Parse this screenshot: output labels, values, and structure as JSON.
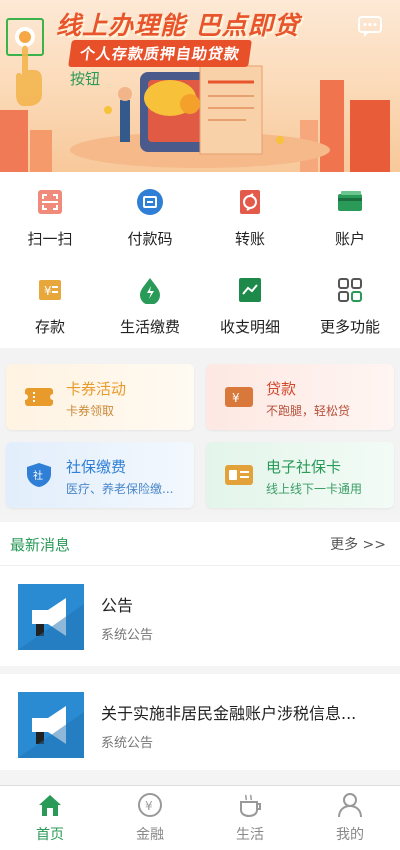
{
  "banner": {
    "title": "线上办理能 巴点即贷",
    "subtitle": "个人存款质押自助贷款",
    "hint": "按钮"
  },
  "icons": {
    "scan": "scan-icon",
    "message": "message-icon"
  },
  "grid": [
    {
      "label": "扫一扫",
      "icon": "scan-icon"
    },
    {
      "label": "付款码",
      "icon": "payment-code-icon"
    },
    {
      "label": "转账",
      "icon": "transfer-icon"
    },
    {
      "label": "账户",
      "icon": "account-card-icon"
    },
    {
      "label": "存款",
      "icon": "deposit-icon"
    },
    {
      "label": "生活缴费",
      "icon": "life-payment-icon"
    },
    {
      "label": "收支明细",
      "icon": "statement-icon"
    },
    {
      "label": "更多功能",
      "icon": "more-grid-icon"
    }
  ],
  "cards": [
    {
      "title": "卡券活动",
      "subtitle": "卡券领取",
      "title_color": "#e89a2b"
    },
    {
      "title": "贷款",
      "subtitle": "不跑腿，轻松贷",
      "title_color": "#d2452a"
    },
    {
      "title": "社保缴费",
      "subtitle": "医疗、养老保险缴...",
      "title_color": "#2f7fd6"
    },
    {
      "title": "电子社保卡",
      "subtitle": "线上线下一卡通用",
      "title_color": "#2a9a58"
    }
  ],
  "news": {
    "header": "最新消息",
    "more": "更多 >>",
    "items": [
      {
        "title": "公告",
        "source": "系统公告"
      },
      {
        "title": "关于实施非居民金融账户涉税信息...",
        "source": "系统公告"
      }
    ]
  },
  "tabs": [
    {
      "label": "首页",
      "icon": "home-icon",
      "active": true
    },
    {
      "label": "金融",
      "icon": "finance-icon",
      "active": false
    },
    {
      "label": "生活",
      "icon": "life-cup-icon",
      "active": false
    },
    {
      "label": "我的",
      "icon": "profile-icon",
      "active": false
    }
  ],
  "colors": {
    "accent": "#2a9a58",
    "banner_red": "#e8542c"
  }
}
